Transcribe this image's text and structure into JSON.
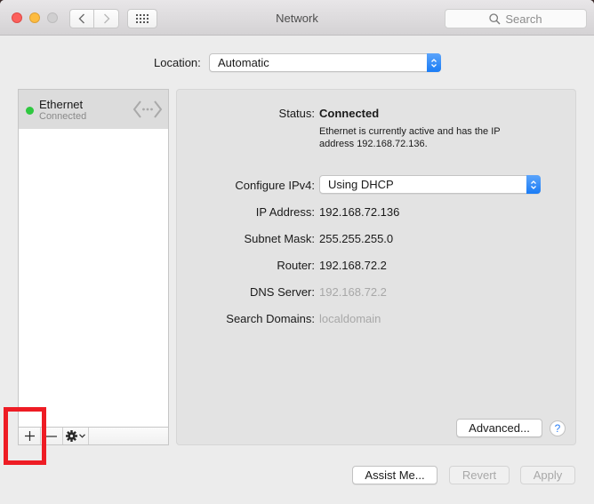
{
  "window": {
    "title": "Network",
    "search_placeholder": "Search"
  },
  "location": {
    "label": "Location:",
    "value": "Automatic"
  },
  "sidebar": {
    "items": [
      {
        "name": "Ethernet",
        "status": "Connected",
        "status_color": "#2fc840"
      }
    ],
    "toolbar": {
      "add": "+",
      "remove": "—"
    }
  },
  "detail": {
    "status_label": "Status:",
    "status_value": "Connected",
    "status_description": "Ethernet is currently active and has the IP address 192.168.72.136.",
    "configure_label": "Configure IPv4:",
    "configure_value": "Using DHCP",
    "ip_label": "IP Address:",
    "ip_value": "192.168.72.136",
    "subnet_label": "Subnet Mask:",
    "subnet_value": "255.255.255.0",
    "router_label": "Router:",
    "router_value": "192.168.72.2",
    "dns_label": "DNS Server:",
    "dns_value": "192.168.72.2",
    "domains_label": "Search Domains:",
    "domains_value": "localdomain",
    "advanced_button": "Advanced...",
    "help_button": "?"
  },
  "footer": {
    "assist_button": "Assist Me...",
    "revert_button": "Revert",
    "apply_button": "Apply"
  },
  "colors": {
    "accent": "#1a7cf5",
    "highlight_box": "#ee1c24",
    "connected": "#2fc840"
  }
}
